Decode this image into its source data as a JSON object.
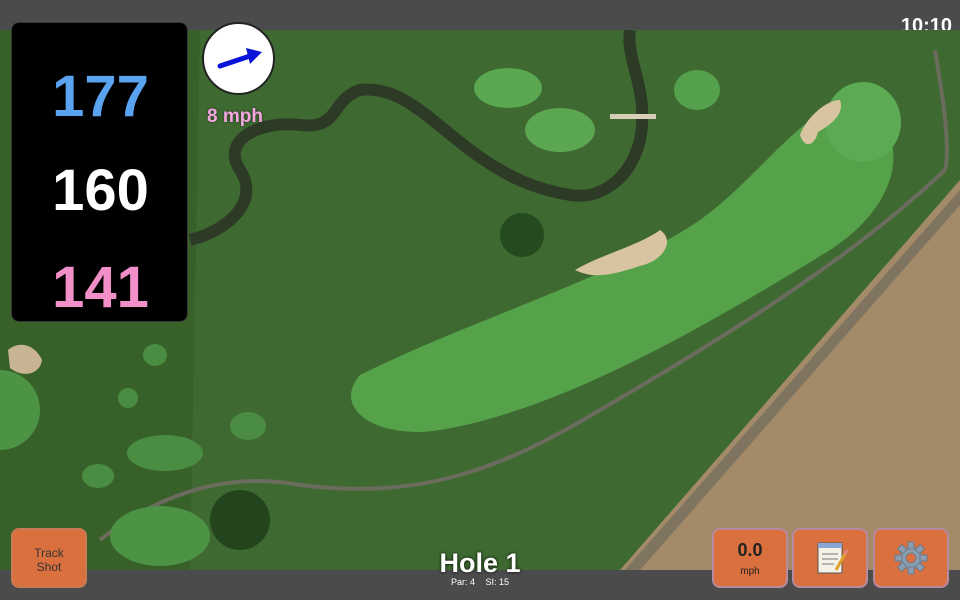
{
  "status": {
    "time": "10:10"
  },
  "distances": {
    "back": "177",
    "middle": "160",
    "front": "141"
  },
  "wind": {
    "speed_label": "8 mph",
    "direction": "arrow-right-up"
  },
  "hole": {
    "title": "Hole 1",
    "par_label": "Par: 4",
    "si_label": "SI: 15"
  },
  "buttons": {
    "track_shot_line1": "Track",
    "track_shot_line2": "Shot",
    "wind_value": "0.0",
    "wind_unit": "mph",
    "notes_icon": "notepad-icon",
    "settings_icon": "gear-icon"
  },
  "colors": {
    "back_distance": "#5aa3f0",
    "middle_distance": "#ffffff",
    "front_distance": "#f28fc8",
    "button": "#d9703e",
    "wind_label": "#f5a7e0"
  }
}
